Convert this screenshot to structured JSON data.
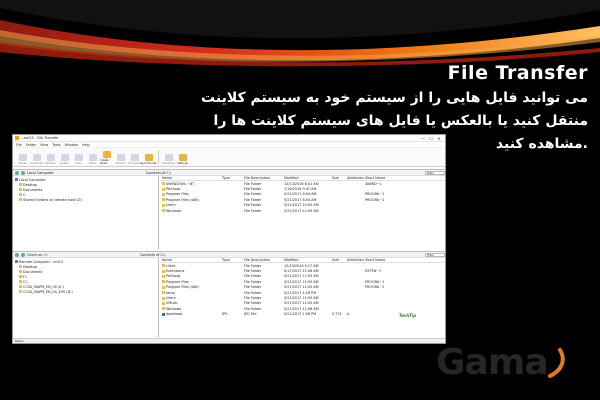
{
  "slide": {
    "heading": "File Transfer",
    "lines": [
      "می توانید فایل هایی را از سیستم خود به سیستم کلاینت",
      "منتقل کنید یا بالعکس یا فایل های سیستم کلاینت ها را",
      ".مشاهده کنید"
    ],
    "logo_text": "Gama",
    "colors": {
      "band_red": "#d62d1c",
      "band_orange": "#f07a15",
      "background": "#000000",
      "logo_gray": "#262626",
      "logo_orange": "#e27b1e"
    }
  },
  "window": {
    "title": "- eni13 - File Transfer",
    "controls": [
      "—",
      "☐",
      "✕"
    ],
    "menu": [
      "File",
      "Folder",
      "View",
      "Tools",
      "Window",
      "Help"
    ],
    "toolbar": [
      {
        "label": "Upload",
        "active": false
      },
      {
        "label": "Download",
        "active": false
      },
      {
        "label": "Rename",
        "active": false
      },
      {
        "label": "Delete",
        "active": false
      },
      {
        "label": "Copy",
        "active": false
      },
      {
        "label": "Paste",
        "active": false
      },
      {
        "label": "Create folder",
        "active": true
      },
      {
        "label": "Refresh",
        "active": false
      },
      {
        "label": "Compress",
        "active": false
      },
      {
        "label": "Synchronize",
        "active": true
      },
      {
        "label": "Properties",
        "active": false
      },
      {
        "label": "Settings",
        "active": true
      }
    ],
    "status": "Ready",
    "watermark": "TechTip"
  },
  "local_pane": {
    "path": "Local Computer",
    "filter_placeholder": "Filter",
    "contents_label": "Contents of C:\\",
    "tree": [
      {
        "label": "Local Computer",
        "root": true
      },
      {
        "label": "Desktop",
        "root": false
      },
      {
        "label": "Documents",
        "root": false
      },
      {
        "label": "C:",
        "root": false
      },
      {
        "label": "Shared Folders on remote host (Z:)",
        "root": false
      }
    ],
    "columns": [
      "Name",
      "Type",
      "File Description",
      "Modified",
      "Size",
      "Attributes",
      "Short Name"
    ],
    "rows": [
      [
        "$WINDOWS.~BT",
        "",
        "File Folder",
        "12/13/2016 8:41 AM",
        "",
        "",
        "$WIND~1"
      ],
      [
        "PerfLogs",
        "",
        "File Folder",
        "7/16/2016 9:47 AM",
        "",
        "",
        ""
      ],
      [
        "Program Files",
        "",
        "File Folder",
        "5/21/2017 8:04 AM",
        "",
        "",
        "PROGRA~1"
      ],
      [
        "Program Files (x86)",
        "",
        "File Folder",
        "5/21/2017 8:04 AM",
        "",
        "",
        "PROGRA~2"
      ],
      [
        "Users",
        "",
        "File Folder",
        "5/21/2017 10:00 AM",
        "",
        "",
        ""
      ],
      [
        "Windows",
        "",
        "File Folder",
        "5/21/2017 11:05 AM",
        "",
        "",
        ""
      ]
    ]
  },
  "remote_pane": {
    "path": "Client on: C:",
    "filter_placeholder": "Filter",
    "contents_label": "Contents of C:\\",
    "tree": [
      {
        "label": "Remote Computer - eni13",
        "root": true
      },
      {
        "label": "Desktop",
        "root": false
      },
      {
        "label": "Documents",
        "root": false
      },
      {
        "label": "F:\\",
        "root": false
      },
      {
        "label": "C:\\",
        "root": false
      },
      {
        "label": "CCSA_MAPM_EN_US (E:)",
        "root": false
      },
      {
        "label": "CCSA_MAPM_EN_US_EVS (D:)",
        "root": false
      }
    ],
    "columns": [
      "Name",
      "Type",
      "File Description",
      "Modified",
      "Size",
      "Attributes",
      "Short Name"
    ],
    "rows": [
      [
        "client",
        "",
        "File Folder",
        "12/13/2016 9:27 AM",
        "",
        "",
        ""
      ],
      [
        "Extensions",
        "",
        "File Folder",
        "5/17/2017 11:08 AM",
        "",
        "",
        "EXTEN~1"
      ],
      [
        "PerfLogs",
        "",
        "File Folder",
        "5/21/2017 11:05 AM",
        "",
        "",
        ""
      ],
      [
        "Program Files",
        "",
        "File Folder",
        "5/21/2017 11:05 AM",
        "",
        "",
        "PROGRA~1"
      ],
      [
        "Program Files (x86)",
        "",
        "File Folder",
        "5/21/2017 11:05 AM",
        "",
        "",
        "PROGRA~2"
      ],
      [
        "temp",
        "",
        "File Folder",
        "5/21/2017 1:29 PM",
        "",
        "",
        ""
      ],
      [
        "Users",
        "",
        "File Folder",
        "5/21/2017 11:05 AM",
        "",
        "",
        ""
      ],
      [
        "VMLab",
        "",
        "File Folder",
        "5/21/2017 11:05 AM",
        "",
        "",
        ""
      ],
      [
        "Windows",
        "",
        "File Folder",
        "5/21/2017 11:08 AM",
        "",
        "",
        ""
      ],
      [
        "download",
        "JPG",
        "JPG File",
        "5/21/2017 1:08 PM",
        "5,772",
        "A",
        ""
      ]
    ]
  }
}
